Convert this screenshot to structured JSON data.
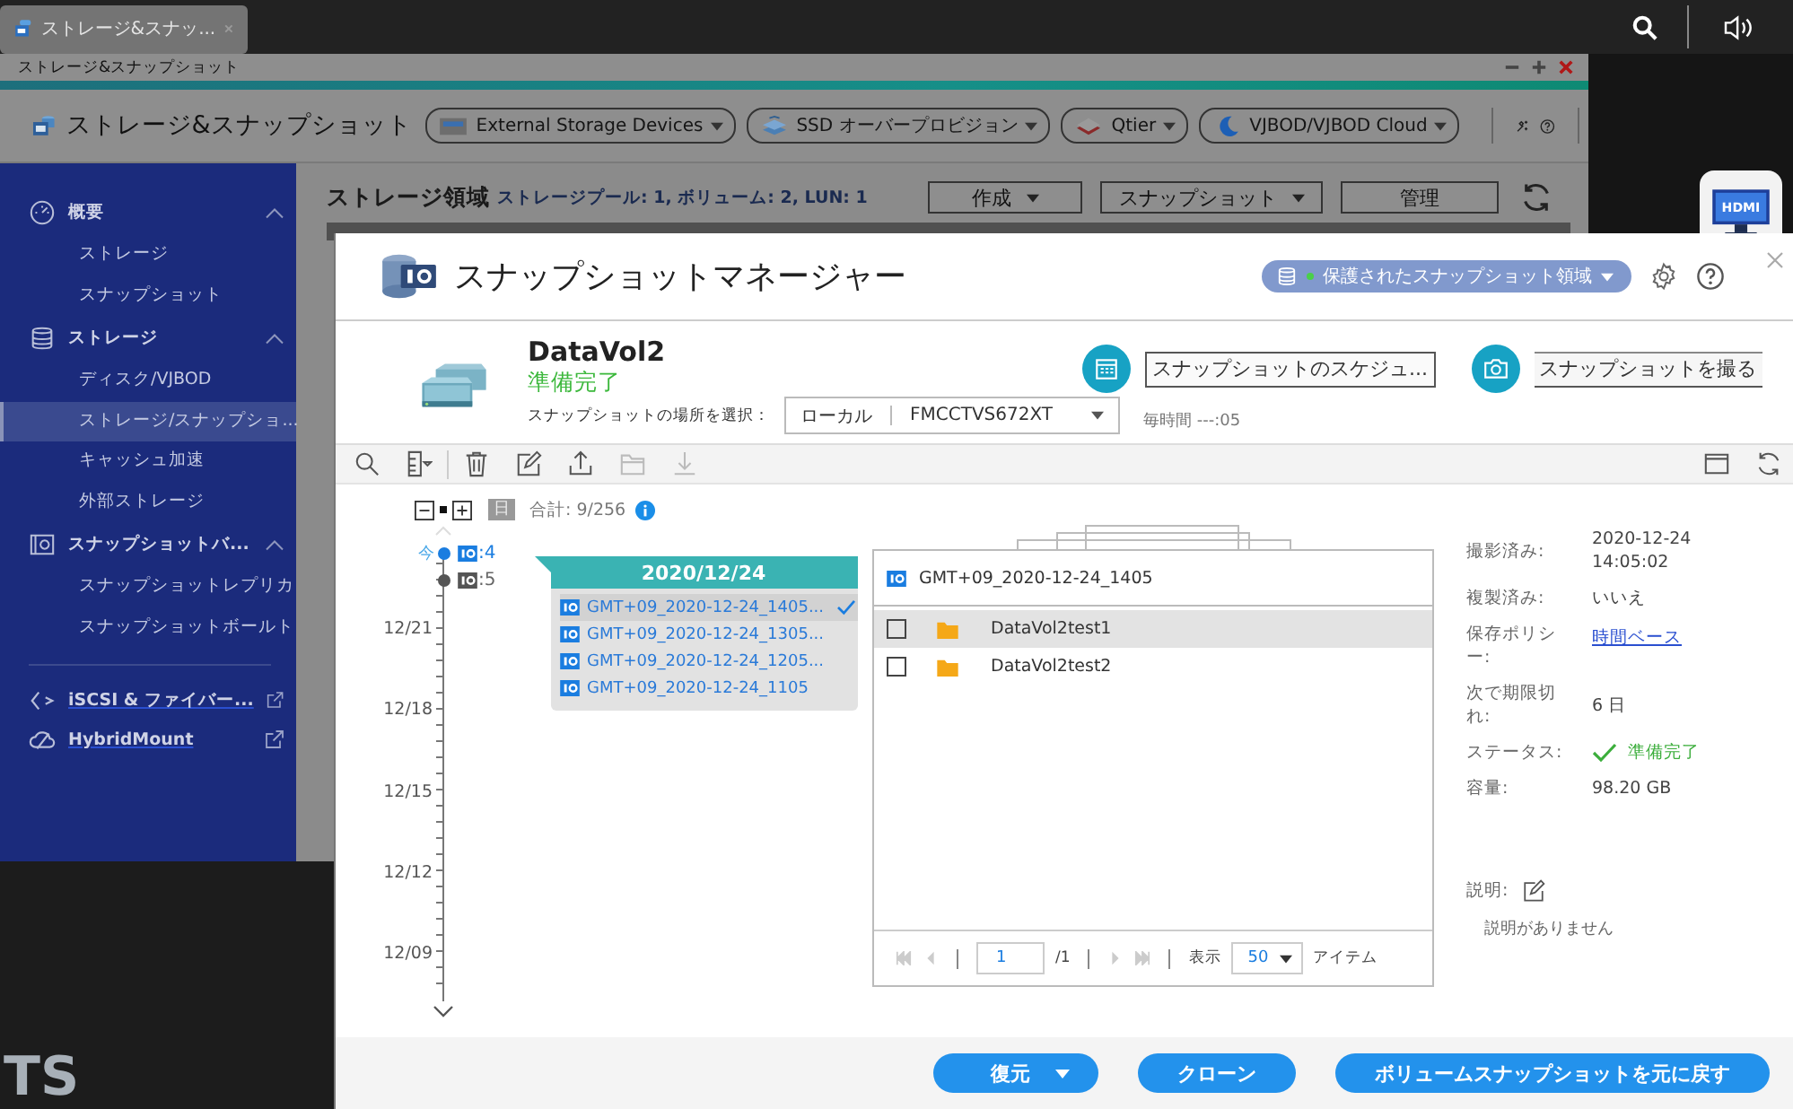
{
  "taskbar": {
    "tab": {
      "title": "ストレージ&スナッ...",
      "selected": true
    }
  },
  "app_window": {
    "title": "ストレージ&スナップショット",
    "app_name": "ストレージ&スナップショット",
    "toolbar_buttons": [
      "External Storage Devices",
      "SSD オーバープロビジョン",
      "Qtier",
      "VJBOD/VJBOD Cloud"
    ],
    "sidebar": [
      {
        "label": "概要",
        "expanded": true,
        "children": [
          {
            "label": "ストレージ",
            "selected": false
          },
          {
            "label": "スナップショット",
            "selected": false
          }
        ]
      },
      {
        "label": "ストレージ",
        "expanded": true,
        "children": [
          {
            "label": "ディスク/VJBOD",
            "selected": false
          },
          {
            "label": "ストレージ/スナップショ...",
            "selected": true
          },
          {
            "label": "キャッシュ加速",
            "selected": false
          },
          {
            "label": "外部ストレージ",
            "selected": false
          }
        ]
      },
      {
        "label": "スナップショットバ...",
        "expanded": true,
        "children": [
          {
            "label": "スナップショットレプリカ",
            "selected": false
          },
          {
            "label": "スナップショットボールト",
            "selected": false
          }
        ]
      }
    ],
    "links": [
      "iSCSI & ファイバー...",
      "HybridMount"
    ],
    "heading": "ストレージ領域",
    "summary": "ストレージプール: 1, ボリューム: 2, LUN: 1",
    "actions": [
      {
        "label": "作成",
        "dropdown": true
      },
      {
        "label": "スナップショット",
        "dropdown": true
      },
      {
        "label": "管理",
        "dropdown": false
      }
    ]
  },
  "desktop": {
    "shortcut": "HDMI",
    "corner_text": "TS"
  },
  "dialog": {
    "title": "スナップショットマネージャー",
    "scope": "保護されたスナップショット領域",
    "volume": {
      "name": "DataVol2",
      "status": "準備完了",
      "location_label": "スナップショットの場所を選択：",
      "location": "ローカル",
      "device": "FMCCTVS672XT"
    },
    "schedule": {
      "button": "スナップショットのスケジュ...",
      "note": "毎時間 ---:05"
    },
    "take_button": "スナップショットを撮る",
    "toolbar": [
      {
        "disabled": false
      },
      {
        "disabled": false
      },
      {
        "disabled": false
      },
      {
        "disabled": false
      },
      {
        "disabled": false
      },
      {
        "disabled": true
      },
      {
        "disabled": true
      }
    ],
    "toolbar_right": [
      {
        "disabled": false
      },
      {
        "disabled": false
      }
    ],
    "timeline": {
      "view": "日",
      "total": "合計: 9/256",
      "now_label": "今",
      "nodes": [
        {
          "label": ":4",
          "selected": true
        },
        {
          "label": ":5",
          "selected": false
        }
      ],
      "dates": [
        "12/21",
        "12/18",
        "12/15",
        "12/12",
        "12/09"
      ]
    },
    "day_popup": {
      "date": "2020/12/24",
      "snapshots": [
        {
          "name": "GMT+09_2020-12-24_1405...",
          "selected": true
        },
        {
          "name": "GMT+09_2020-12-24_1305...",
          "selected": false
        },
        {
          "name": "GMT+09_2020-12-24_1205...",
          "selected": false
        },
        {
          "name": "GMT+09_2020-12-24_1105",
          "selected": false
        }
      ]
    },
    "file_panel": {
      "title": "GMT+09_2020-12-24_1405",
      "files": [
        {
          "name": "DataVol2test1",
          "checked": false,
          "selected": true
        },
        {
          "name": "DataVol2test2",
          "checked": false,
          "selected": false
        }
      ],
      "pager": {
        "page": "1",
        "pages": "/1",
        "show_label": "表示",
        "per_page": "50",
        "items_label": "アイテム"
      }
    },
    "details": [
      {
        "label": "撮影済み:",
        "value": "2020-12-24 14:05:02",
        "kind": "text"
      },
      {
        "label": "複製済み:",
        "value": "いいえ",
        "kind": "text"
      },
      {
        "label": "保存ポリシー:",
        "value": "時間ベース",
        "kind": "link"
      },
      {
        "label": "次で期限切れ:",
        "value": "6 日",
        "kind": "text"
      },
      {
        "label": "ステータス:",
        "value": "準備完了",
        "kind": "status"
      },
      {
        "label": "容量:",
        "value": "98.20 GB",
        "kind": "text"
      }
    ],
    "description": {
      "label": "説明:",
      "value": "説明がありません"
    },
    "footer_buttons": [
      {
        "label": "復元",
        "dropdown": true
      },
      {
        "label": "クローン",
        "dropdown": false
      },
      {
        "label": "ボリュームスナップショットを元に戻す",
        "dropdown": false
      }
    ]
  }
}
